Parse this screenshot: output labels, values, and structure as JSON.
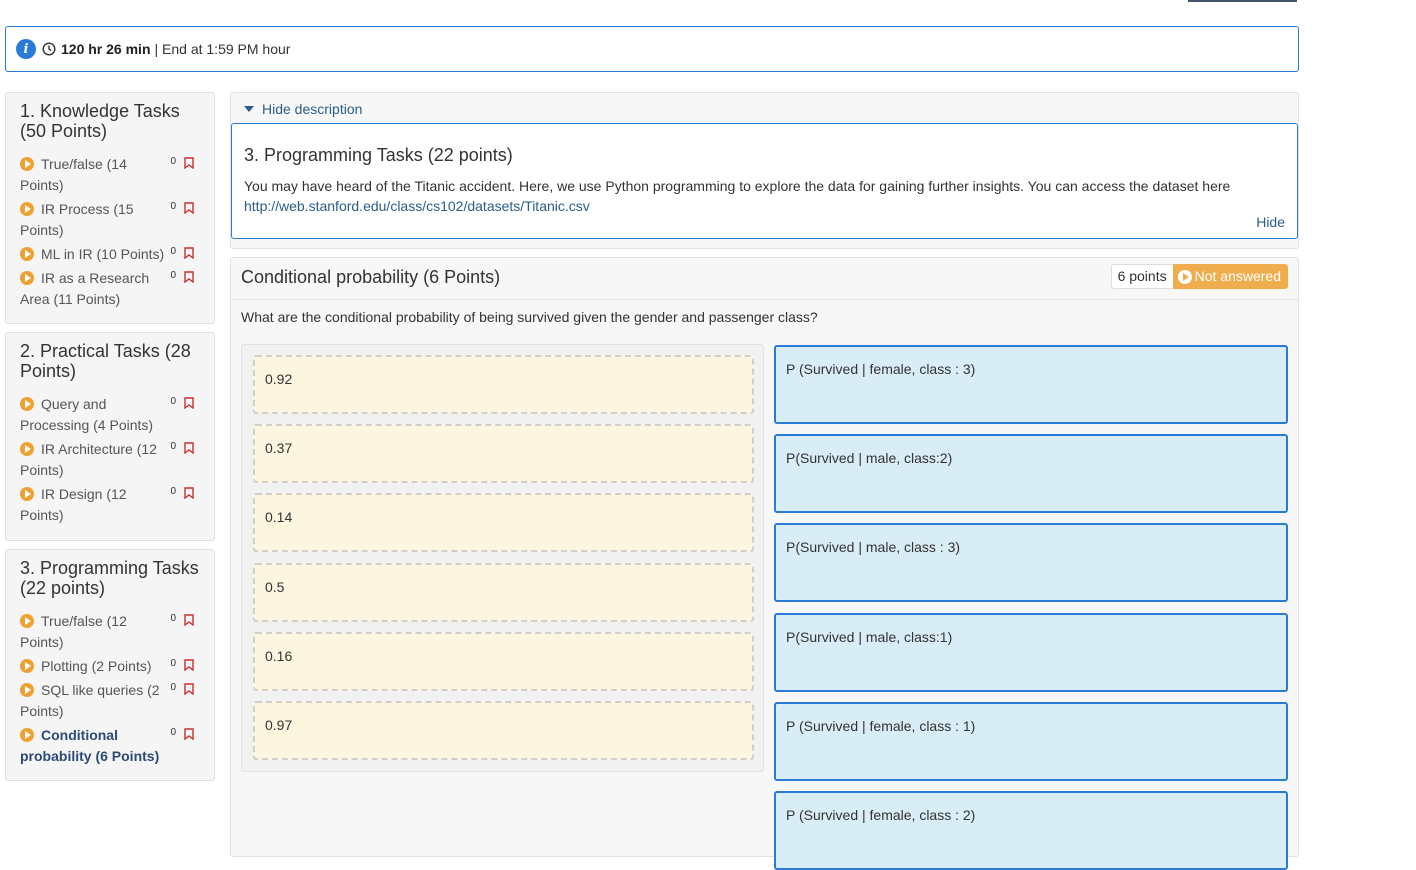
{
  "timer": {
    "duration": "120 hr 26 min",
    "end_text": "| End at 1:59 PM hour"
  },
  "sidebar": {
    "sections": [
      {
        "title": "1. Knowledge Tasks (50 Points)",
        "items": [
          {
            "label": "True/false (14 Points)",
            "count": "0"
          },
          {
            "label": "IR Process (15 Points)",
            "count": "0"
          },
          {
            "label": "ML in IR (10 Points)",
            "count": "0"
          },
          {
            "label": "IR as a Research Area (11 Points)",
            "count": "0"
          }
        ]
      },
      {
        "title": "2. Practical Tasks (28 Points)",
        "items": [
          {
            "label": "Query and Processing (4 Points)",
            "count": "0"
          },
          {
            "label": "IR Architecture (12 Points)",
            "count": "0"
          },
          {
            "label": "IR Design (12 Points)",
            "count": "0"
          }
        ]
      },
      {
        "title": "3. Programming Tasks (22 points)",
        "items": [
          {
            "label": "True/false (12 Points)",
            "count": "0"
          },
          {
            "label": "Plotting (2 Points)",
            "count": "0"
          },
          {
            "label": "SQL like queries (2 Points)",
            "count": "0"
          },
          {
            "label": "Conditional probability (6 Points)",
            "count": "0"
          }
        ]
      }
    ]
  },
  "description": {
    "toggle_label": "Hide description",
    "title": "3. Programming Tasks (22 points)",
    "text": "You may have heard of the Titanic accident. Here, we use Python programming to explore the data for gaining further insights. You can access the dataset here",
    "link": "http://web.stanford.edu/class/cs102/datasets/Titanic.csv",
    "hide_label": "Hide"
  },
  "question": {
    "title": "Conditional probability (6 Points)",
    "points": "6 points",
    "status": "Not answered",
    "prompt": "What are the conditional probability of being survived given the gender and passenger class?",
    "choices": [
      "0.92",
      "0.37",
      "0.14",
      "0.5",
      "0.16",
      "0.97"
    ],
    "targets": [
      "P (Survived | female, class : 3)",
      "P(Survived | male, class:2)",
      "P(Survived | male, class : 3)",
      "P(Survived | male, class:1)",
      "P (Survived | female, class : 1)",
      "P (Survived | female, class : 2)"
    ]
  },
  "colors": {
    "accent": "#2a7bd8",
    "play_icon": "#f0a030",
    "status_badge": "#f0ad4e",
    "bookmark": "#c9302c",
    "choice_bg": "#fcf6e1",
    "target_bg": "#d9edf7"
  }
}
